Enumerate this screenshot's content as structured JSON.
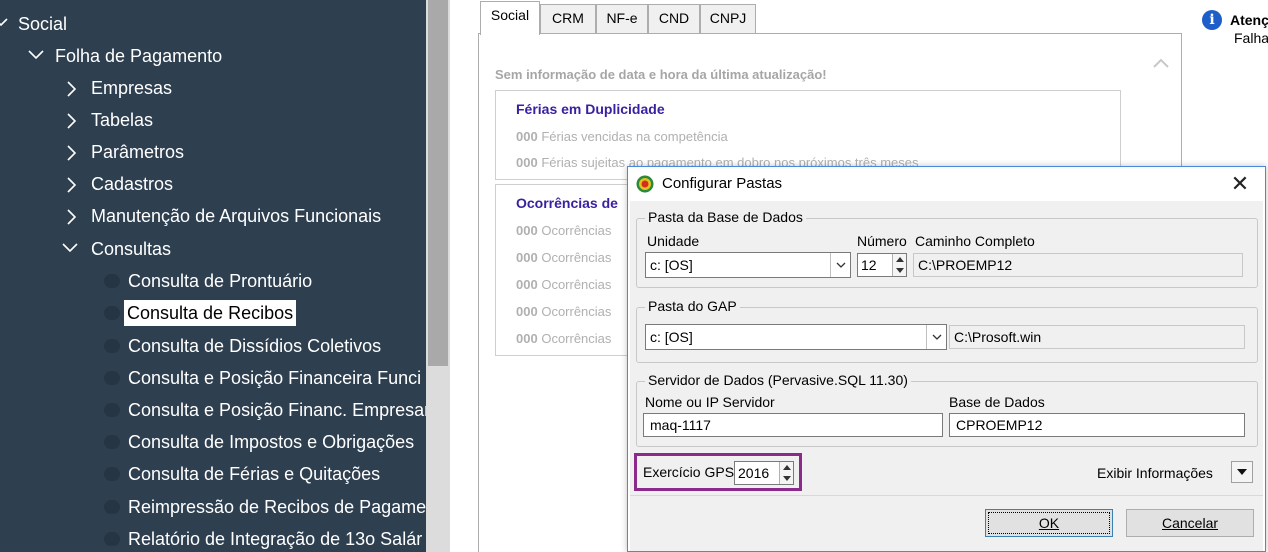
{
  "tree": {
    "items": [
      {
        "label": "Social",
        "expanded": true
      },
      {
        "label": "Folha de Pagamento",
        "expanded": true
      },
      {
        "label": "Empresas",
        "expanded": false
      },
      {
        "label": "Tabelas",
        "expanded": false
      },
      {
        "label": "Parâmetros",
        "expanded": false
      },
      {
        "label": "Cadastros",
        "expanded": false
      },
      {
        "label": "Manutenção de Arquivos Funcionais",
        "expanded": false
      },
      {
        "label": "Consultas",
        "expanded": true
      },
      {
        "label": "Consulta de Prontuário"
      },
      {
        "label": "Consulta de Recibos",
        "selected": true
      },
      {
        "label": "Consulta de Dissídios Coletivos"
      },
      {
        "label": "Consulta e Posição Financeira Funci"
      },
      {
        "label": "Consulta e Posição Financ. Empresar"
      },
      {
        "label": "Consulta de Impostos e Obrigações"
      },
      {
        "label": "Consulta de Férias e Quitações"
      },
      {
        "label": "Reimpressão de Recibos de Pagamen"
      },
      {
        "label": "Relatório de Integração de 13o Salár"
      }
    ]
  },
  "tabs": [
    {
      "label": "Social",
      "active": true
    },
    {
      "label": "CRM"
    },
    {
      "label": "NF-e"
    },
    {
      "label": "CND"
    },
    {
      "label": "CNPJ"
    }
  ],
  "panel": {
    "last_update": "Sem informação de data e hora da última atualização!",
    "group1": {
      "title": "Férias em Duplicidade",
      "rows": [
        {
          "count": "000",
          "text": "Férias vencidas na competência"
        },
        {
          "count": "000",
          "text": "Férias sujeitas ao pagamento em dobro nos próximos três meses"
        }
      ]
    },
    "group2": {
      "title": "Ocorrências de",
      "rows": [
        {
          "count": "000",
          "text": "Ocorrências"
        },
        {
          "count": "000",
          "text": "Ocorrências"
        },
        {
          "count": "000",
          "text": "Ocorrências"
        },
        {
          "count": "000",
          "text": "Ocorrências"
        },
        {
          "count": "000",
          "text": "Ocorrências"
        }
      ]
    }
  },
  "attention": {
    "title": "Atenç",
    "subtitle": "Falha"
  },
  "dialog": {
    "title": "Configurar Pastas",
    "base": {
      "legend": "Pasta da Base de Dados",
      "unidade_label": "Unidade",
      "unidade_value": "c: [OS]",
      "numero_label": "Número",
      "numero_value": "12",
      "caminho_label": "Caminho Completo",
      "caminho_value": "C:\\PROEMP12"
    },
    "gap": {
      "legend": "Pasta do GAP",
      "drive_value": "c: [OS]",
      "path_value": "C:\\Prosoft.win"
    },
    "server": {
      "legend": "Servidor de Dados (Pervasive.SQL 11.30)",
      "host_label": "Nome ou IP Servidor",
      "host_value": "maq-1117",
      "db_label": "Base de Dados",
      "db_value": "CPROEMP12"
    },
    "exercicio_label": "Exercício GPS",
    "exercicio_value": "2016",
    "exibir_label": "Exibir Informações",
    "ok_label": "OK",
    "cancel_label": "Cancelar"
  },
  "colors": {
    "tree_bg": "#2e3f50",
    "group_title": "#3a1fa0",
    "highlight_box": "#8a2a8a",
    "info_icon": "#1e5ec8"
  }
}
